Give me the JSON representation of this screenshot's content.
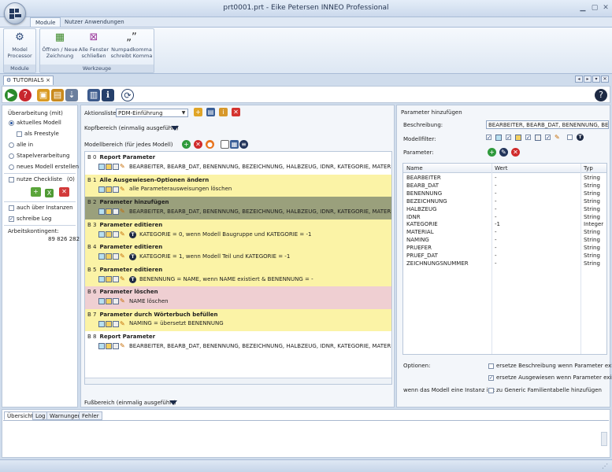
{
  "window": {
    "title": "prt0001.prt - Eike Petersen INNEO Professional"
  },
  "ribbon": {
    "tabs": [
      "Module",
      "Nutzer Anwendungen"
    ],
    "groups": [
      {
        "label": "Module",
        "buttons": [
          {
            "line1": "Model",
            "line2": "Processor",
            "icon": "gears-icon"
          }
        ]
      },
      {
        "label": "Werkzeuge",
        "buttons": [
          {
            "line1": "Öffnen / Neue",
            "line2": "Zeichnung",
            "icon": "open-drawing-icon"
          },
          {
            "line1": "Alle Fenster",
            "line2": "schließen",
            "icon": "close-windows-icon"
          },
          {
            "line1": "Numpadkomma",
            "line2": "schreibt Komma",
            "icon": "comma-icon"
          }
        ]
      }
    ]
  },
  "doc_tab": {
    "label": "TUTORIALS",
    "close": "×"
  },
  "left_panel": {
    "title": "Überarbeitung (mit)",
    "options": [
      "aktuelles Modell",
      "alle in",
      "Stapelverarbeitung",
      "neues Modell erstellen"
    ],
    "freestyle": "als Freestyle",
    "checklist": "nutze Checkliste",
    "checklist_count": "(0)",
    "instances": "auch über Instanzen",
    "log": "schreibe Log",
    "quota_label": "Arbeitskontingent:",
    "quota_value": "89 826 282"
  },
  "middle": {
    "aktionsliste_label": "Aktionsliste",
    "aktionsliste_value": "PDM-Einführung",
    "kopfbereich": "Kopfbereich (einmalig ausgeführt)",
    "modellbereich": "Modellbereich (für jedes Modell)",
    "fussbereich": "Fußbereich (einmalig ausgeführt)",
    "blocks": [
      {
        "id": "B 0",
        "title": "Report Parameter",
        "text": "BEARBEITER, BEARB_DAT, BENENNUNG, BEZEICHNUNG, HALBZEUG, IDNR, KATEGORIE, MATERIAL, NAMING, PRUEFER, PRUEF_DAT, ZEICHNUNGSNUMMER"
      },
      {
        "id": "B 1",
        "title": "Alle Ausgewiesen-Optionen ändern",
        "text": "alle Parameterausweisungen löschen"
      },
      {
        "id": "B 2",
        "title": "Parameter hinzufügen",
        "text": "BEARBEITER, BEARB_DAT, BENENNUNG, BEZEICHNUNG, HALBZEUG, IDNR, KATEGORIE, MATERIAL, NAMING, PRUEFER, PRUEF_DAT, ZEICHNUNGSNUMMER"
      },
      {
        "id": "B 3",
        "title": "Parameter editieren",
        "text": "KATEGORIE = 0, wenn Modell Baugruppe und KATEGORIE = -1"
      },
      {
        "id": "B 4",
        "title": "Parameter editieren",
        "text": "KATEGORIE = 1, wenn Modell Teil und KATEGORIE = -1"
      },
      {
        "id": "B 5",
        "title": "Parameter editieren",
        "text": "BENENNUNG = NAME, wenn NAME existiert & BENENNUNG = -"
      },
      {
        "id": "B 6",
        "title": "Parameter löschen",
        "text": "NAME löschen"
      },
      {
        "id": "B 7",
        "title": "Parameter durch Wörterbuch befüllen",
        "text": "NAMING = übersetzt BENENNUNG"
      },
      {
        "id": "B 8",
        "title": "Report Parameter",
        "text": "BEARBEITER, BEARB_DAT, BENENNUNG, BEZEICHNUNG, HALBZEUG, IDNR, KATEGORIE, MATERIAL, NAMING, PRUEFER, PRUEF_DAT, ZEICHNUNGSNUMMER"
      }
    ]
  },
  "right": {
    "title": "Parameter hinzufügen",
    "beschreibung_label": "Beschreibung:",
    "beschreibung_value": "BEARBEITER, BEARB_DAT, BENENNUNG, BEZEICHNUNG, HALBZEUG, IDNR, KATEGORIE, MATERIAL, NAMING, PRUEFER, PRUEF_DAT, ZEICHNUNGSNUMMER",
    "modellfilter_label": "Modellfilter:",
    "parameter_label": "Parameter:",
    "columns": [
      "Name",
      "Wert",
      "Typ"
    ],
    "rows": [
      [
        "BEARBEITER",
        "-",
        "String"
      ],
      [
        "BEARB_DAT",
        "-",
        "String"
      ],
      [
        "BENENNUNG",
        "-",
        "String"
      ],
      [
        "BEZEICHNUNG",
        "-",
        "String"
      ],
      [
        "HALBZEUG",
        "-",
        "String"
      ],
      [
        "IDNR",
        "-",
        "String"
      ],
      [
        "KATEGORIE",
        "-1",
        "Integer"
      ],
      [
        "MATERIAL",
        "-",
        "String"
      ],
      [
        "NAMING",
        "-",
        "String"
      ],
      [
        "PRUEFER",
        "-",
        "String"
      ],
      [
        "PRUEF_DAT",
        "-",
        "String"
      ],
      [
        "ZEICHNUNGSNUMMER",
        "-",
        "String"
      ]
    ],
    "optionen_label": "Optionen:",
    "opt1": "ersetze Beschreibung wenn Parameter existiert",
    "opt2": "ersetze Ausgewiesen wenn Parameter existiert",
    "instanz_label": "wenn das Modell eine Instanz ist:",
    "opt3": "zu Generic Familientabelle hinzufügen"
  },
  "bottom_tabs": [
    "Übersicht",
    "Log",
    "Warnungen",
    "Fehler"
  ],
  "colors": {
    "yellow": "#fbf3a6",
    "olive": "#9aa07c",
    "pink": "#efcfd2",
    "grey": "#ececec"
  }
}
